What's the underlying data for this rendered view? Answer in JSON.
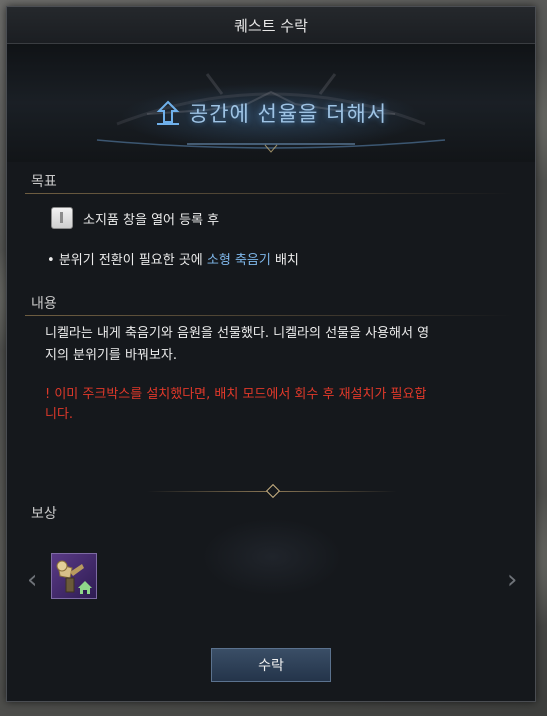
{
  "window": {
    "title": "퀘스트 수락"
  },
  "quest": {
    "title": "공간에 선율을 더해서"
  },
  "objective": {
    "label": "목표",
    "item_text": "소지품 창을 열어 등록 후",
    "bullet": "•",
    "task_prefix": "분위기 전환이 필요한 곳에 ",
    "task_highlight": "소형 축음기",
    "task_suffix": " 배치"
  },
  "content": {
    "label": "내용",
    "lines": [
      "니켈라는 내게 축음기와 음원을 선물했다. 니켈라의 선물을 사용해서 영",
      "지의 분위기를 바꿔보자."
    ],
    "warning_lines": [
      "! 이미 주크박스를 설치했다면, 배치 모드에서 회수 후 재설치가 필요합",
      "니다."
    ]
  },
  "reward": {
    "label": "보상",
    "prev_arrow": "‹",
    "next_arrow": "›"
  },
  "accept_button": {
    "label": "수락"
  },
  "colors": {
    "highlight": "#7fb7ea",
    "warning": "#e0392a",
    "title_glow": "#9ec3e4",
    "item_frame": "#5a3a86"
  },
  "icons": {
    "quest": "quest-arrow-icon",
    "item": "item-book-icon",
    "reward": "gramophone-icon"
  }
}
